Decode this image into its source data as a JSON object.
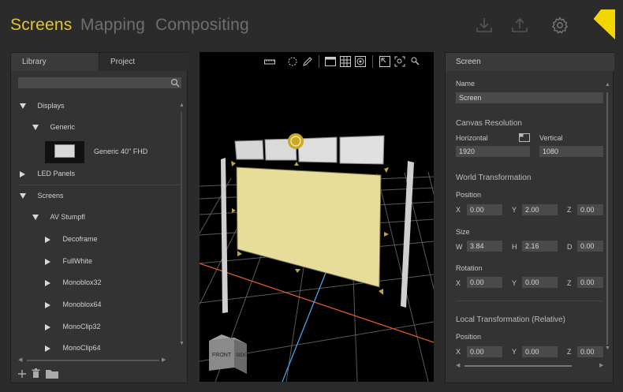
{
  "nav": {
    "tabs": [
      "Screens",
      "Mapping",
      "Compositing"
    ],
    "active": "Screens",
    "accent_color": "#e5c52b",
    "icons": [
      "download-icon",
      "upload-icon",
      "gear-icon",
      "logo-icon"
    ]
  },
  "library": {
    "tabs": [
      "Library",
      "Project"
    ],
    "search_placeholder": "",
    "tree": {
      "displays": "Displays",
      "generic": "Generic",
      "generic_item": "Generic 40\" FHD",
      "led_panels": "LED Panels",
      "screens": "Screens",
      "av_stumpfl": "AV Stumpfl",
      "children": [
        "Decoframe",
        "FullWhite",
        "Monoblox32",
        "Monoblox64",
        "MonoClip32",
        "MonoClip64"
      ]
    },
    "footer_icons": [
      "add-icon",
      "trash-icon",
      "folder-icon"
    ]
  },
  "viewport": {
    "toolbar_icons": [
      "ruler-icon",
      "select-circle-icon",
      "pen-icon",
      "layout-icon",
      "grid-icon",
      "target-icon",
      "frame-icon",
      "zoom-fit-icon",
      "zoom-icon"
    ],
    "cube_labels": {
      "front": "FRONT",
      "side": "SIDE"
    }
  },
  "properties": {
    "header": "Screen",
    "name_label": "Name",
    "name_value": "Screen",
    "canvas_resolution": "Canvas Resolution",
    "horizontal_label": "Horizontal",
    "vertical_label": "Vertical",
    "horizontal_value": "1920",
    "vertical_value": "1080",
    "world_transformation": "World Transformation",
    "position_label": "Position",
    "position": {
      "x": "0.00",
      "y": "2.00",
      "z": "0.00"
    },
    "size_label": "Size",
    "size": {
      "w": "3.84",
      "h": "2.16",
      "d": "0.00"
    },
    "rotation_label": "Rotation",
    "rotation": {
      "x": "0.00",
      "y": "0.00",
      "z": "0.00"
    },
    "local_transformation": "Local Transformation (Relative)",
    "local_position_label": "Position",
    "local_position": {
      "x": "0.00",
      "y": "0.00",
      "z": "0.00"
    },
    "axis_letters": {
      "x": "X",
      "y": "Y",
      "z": "Z",
      "w": "W",
      "h": "H",
      "d": "D"
    }
  }
}
